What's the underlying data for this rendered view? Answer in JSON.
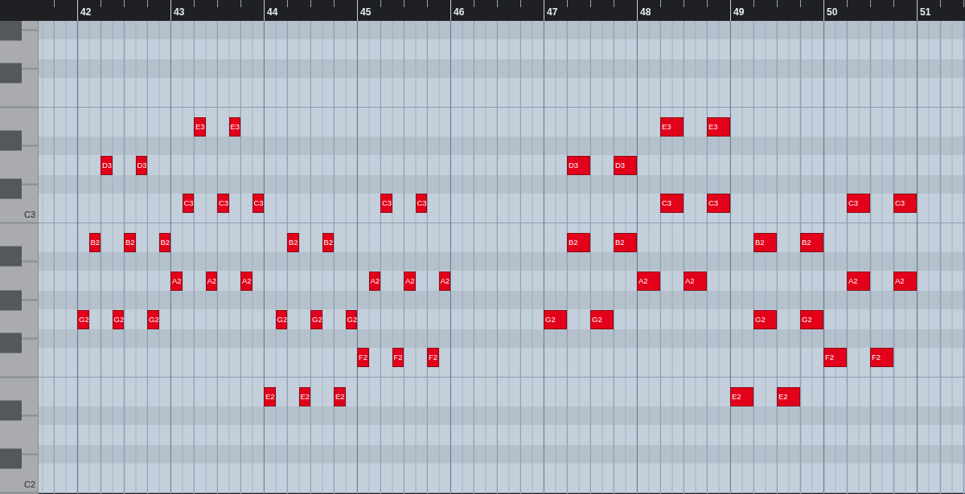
{
  "ruler": {
    "bars": [
      "42",
      "43",
      "44",
      "45",
      "46",
      "47",
      "48",
      "49",
      "50",
      "51"
    ]
  },
  "lanes": [
    {
      "kind": "black"
    },
    {
      "kind": "white"
    },
    {
      "kind": "black"
    },
    {
      "kind": "wideup"
    },
    {
      "kind": "widedown",
      "events": [
        {
          "kind": "barrest"
        },
        {
          "kind": "quarterrest"
        },
        {
          "label": "E3",
          "kind": "eighth"
        },
        {
          "kind": "quarterrest"
        },
        {
          "label": "E3",
          "kind": "eighth"
        },
        {
          "kind": "barrest"
        },
        {
          "kind": "barrest"
        },
        {
          "kind": "barrest"
        },
        {
          "kind": "barrest"
        },
        {
          "kind": "quarterrest"
        },
        {
          "kind": "quarterrest"
        },
        {
          "label": "E3",
          "kind": "quarter"
        },
        {
          "kind": "quarterrest"
        },
        {
          "label": "E3",
          "kind": "quarter"
        }
      ]
    },
    {
      "kind": "black"
    },
    {
      "kind": "white",
      "events": [
        {
          "kind": "quarterrest"
        },
        {
          "label": "D3",
          "kind": "eighth"
        },
        {
          "kind": "quarterrest"
        },
        {
          "label": "D3",
          "kind": "eighth"
        },
        {
          "kind": "barrest"
        },
        {
          "kind": "barrest"
        },
        {
          "kind": "barrest"
        },
        {
          "kind": "barrest"
        },
        {
          "kind": "quarterrest"
        },
        {
          "kind": "quarterrest"
        },
        {
          "label": "D3",
          "kind": "quarter"
        },
        {
          "kind": "quarterrest"
        },
        {
          "label": "D3",
          "kind": "quarter"
        }
      ]
    },
    {
      "kind": "black"
    },
    {
      "kind": "wideup",
      "key_label": "C3",
      "events": [
        {
          "kind": "barrest"
        },
        {
          "kind": "eighthrest"
        },
        {
          "label": "C3",
          "kind": "eighth"
        },
        {
          "kind": "quarterrest"
        },
        {
          "label": "C3",
          "kind": "eighth"
        },
        {
          "kind": "quarterrest"
        },
        {
          "label": "C3",
          "kind": "eighth"
        },
        {
          "kind": "barrest"
        },
        {
          "kind": "quarterrest"
        },
        {
          "label": "C3",
          "kind": "eighth"
        },
        {
          "kind": "quarterrest"
        },
        {
          "label": "C3",
          "kind": "eighth"
        },
        {
          "kind": "barrest"
        },
        {
          "kind": "barrest"
        },
        {
          "kind": "quarterrest"
        },
        {
          "kind": "quarterrest"
        },
        {
          "label": "C3",
          "kind": "quarter"
        },
        {
          "kind": "quarterrest"
        },
        {
          "label": "C3",
          "kind": "quarter"
        },
        {
          "kind": "barrest"
        },
        {
          "kind": "quarterrest"
        },
        {
          "label": "C3",
          "kind": "quarter"
        },
        {
          "kind": "quarterrest"
        },
        {
          "label": "C3",
          "kind": "quarter"
        }
      ]
    },
    {
      "kind": "widedown",
      "events": [
        {
          "kind": "eighthrest"
        },
        {
          "label": "B2",
          "kind": "eighth"
        },
        {
          "kind": "quarterrest"
        },
        {
          "label": "B2",
          "kind": "eighth"
        },
        {
          "kind": "quarterrest"
        },
        {
          "label": "B2",
          "kind": "eighth"
        },
        {
          "kind": "barrest"
        },
        {
          "kind": "quarterrest"
        },
        {
          "label": "B2",
          "kind": "eighth"
        },
        {
          "kind": "quarterrest"
        },
        {
          "label": "B2",
          "kind": "eighth"
        },
        {
          "kind": "barrest"
        },
        {
          "kind": "barrest"
        },
        {
          "kind": "quarterrest"
        },
        {
          "kind": "quarterrest"
        },
        {
          "label": "B2",
          "kind": "quarter"
        },
        {
          "kind": "quarterrest"
        },
        {
          "label": "B2",
          "kind": "quarter"
        },
        {
          "kind": "barrest"
        },
        {
          "kind": "quarterrest"
        },
        {
          "label": "B2",
          "kind": "quarter"
        },
        {
          "kind": "quarterrest"
        },
        {
          "label": "B2",
          "kind": "quarter"
        }
      ]
    },
    {
      "kind": "black"
    },
    {
      "kind": "white",
      "events": [
        {
          "kind": "barrest"
        },
        {
          "label": "A2",
          "kind": "eighth"
        },
        {
          "kind": "quarterrest"
        },
        {
          "label": "A2",
          "kind": "eighth"
        },
        {
          "kind": "quarterrest"
        },
        {
          "label": "A2",
          "kind": "eighth"
        },
        {
          "kind": "barrest"
        },
        {
          "kind": "quarterrest"
        },
        {
          "label": "A2",
          "kind": "eighth"
        },
        {
          "kind": "quarterrest"
        },
        {
          "label": "A2",
          "kind": "eighth"
        },
        {
          "kind": "quarterrest"
        },
        {
          "label": "A2",
          "kind": "eighth"
        },
        {
          "kind": "barrest"
        },
        {
          "kind": "barrest"
        },
        {
          "label": "A2",
          "kind": "quarter"
        },
        {
          "kind": "quarterrest"
        },
        {
          "label": "A2",
          "kind": "quarter"
        },
        {
          "kind": "barrest"
        },
        {
          "kind": "quarterrest"
        },
        {
          "kind": "quarterrest"
        },
        {
          "label": "A2",
          "kind": "quarter"
        },
        {
          "kind": "quarterrest"
        },
        {
          "label": "A2",
          "kind": "quarter"
        }
      ]
    },
    {
      "kind": "black"
    },
    {
      "kind": "white",
      "events": [
        {
          "label": "G2",
          "kind": "eighth"
        },
        {
          "kind": "quarterrest"
        },
        {
          "label": "G2",
          "kind": "eighth"
        },
        {
          "kind": "quarterrest"
        },
        {
          "label": "G2",
          "kind": "eighth"
        },
        {
          "kind": "barrest"
        },
        {
          "kind": "quarterrest"
        },
        {
          "label": "G2",
          "kind": "eighth"
        },
        {
          "kind": "quarterrest"
        },
        {
          "label": "G2",
          "kind": "eighth"
        },
        {
          "kind": "quarterrest"
        },
        {
          "label": "G2",
          "kind": "eighth"
        },
        {
          "kind": "barrest"
        },
        {
          "kind": "barrest"
        },
        {
          "label": "G2",
          "kind": "quarter"
        },
        {
          "kind": "quarterrest"
        },
        {
          "label": "G2",
          "kind": "quarter"
        },
        {
          "kind": "barrest"
        },
        {
          "kind": "quarterrest"
        },
        {
          "kind": "quarterrest"
        },
        {
          "label": "G2",
          "kind": "quarter"
        },
        {
          "kind": "quarterrest"
        },
        {
          "label": "G2",
          "kind": "quarter"
        }
      ]
    },
    {
      "kind": "black"
    },
    {
      "kind": "wideup",
      "events": [
        {
          "kind": "barrest"
        },
        {
          "kind": "barrest"
        },
        {
          "kind": "barrest"
        },
        {
          "label": "F2",
          "kind": "eighth"
        },
        {
          "kind": "quarterrest"
        },
        {
          "label": "F2",
          "kind": "eighth"
        },
        {
          "kind": "quarterrest"
        },
        {
          "label": "F2",
          "kind": "eighth"
        },
        {
          "kind": "barrest"
        },
        {
          "kind": "barrest"
        },
        {
          "kind": "barrest"
        },
        {
          "kind": "barrest"
        },
        {
          "kind": "eighthrest"
        },
        {
          "label": "F2",
          "kind": "quarter"
        },
        {
          "kind": "quarterrest"
        },
        {
          "label": "F2",
          "kind": "quarter"
        }
      ]
    },
    {
      "kind": "widedown",
      "events": [
        {
          "kind": "barrest"
        },
        {
          "kind": "barrest"
        },
        {
          "label": "E2",
          "kind": "eighth"
        },
        {
          "kind": "quarterrest"
        },
        {
          "label": "E2",
          "kind": "eighth"
        },
        {
          "kind": "quarterrest"
        },
        {
          "label": "E2",
          "kind": "eighth"
        },
        {
          "kind": "barrest"
        },
        {
          "kind": "barrest"
        },
        {
          "kind": "barrest"
        },
        {
          "kind": "barrest"
        },
        {
          "kind": "eighthrest"
        },
        {
          "label": "E2",
          "kind": "quarter"
        },
        {
          "kind": "quarterrest"
        },
        {
          "label": "E2",
          "kind": "quarter"
        }
      ]
    },
    {
      "kind": "black"
    },
    {
      "kind": "white"
    },
    {
      "kind": "black"
    },
    {
      "kind": "wideup",
      "key_label": "C2"
    }
  ]
}
